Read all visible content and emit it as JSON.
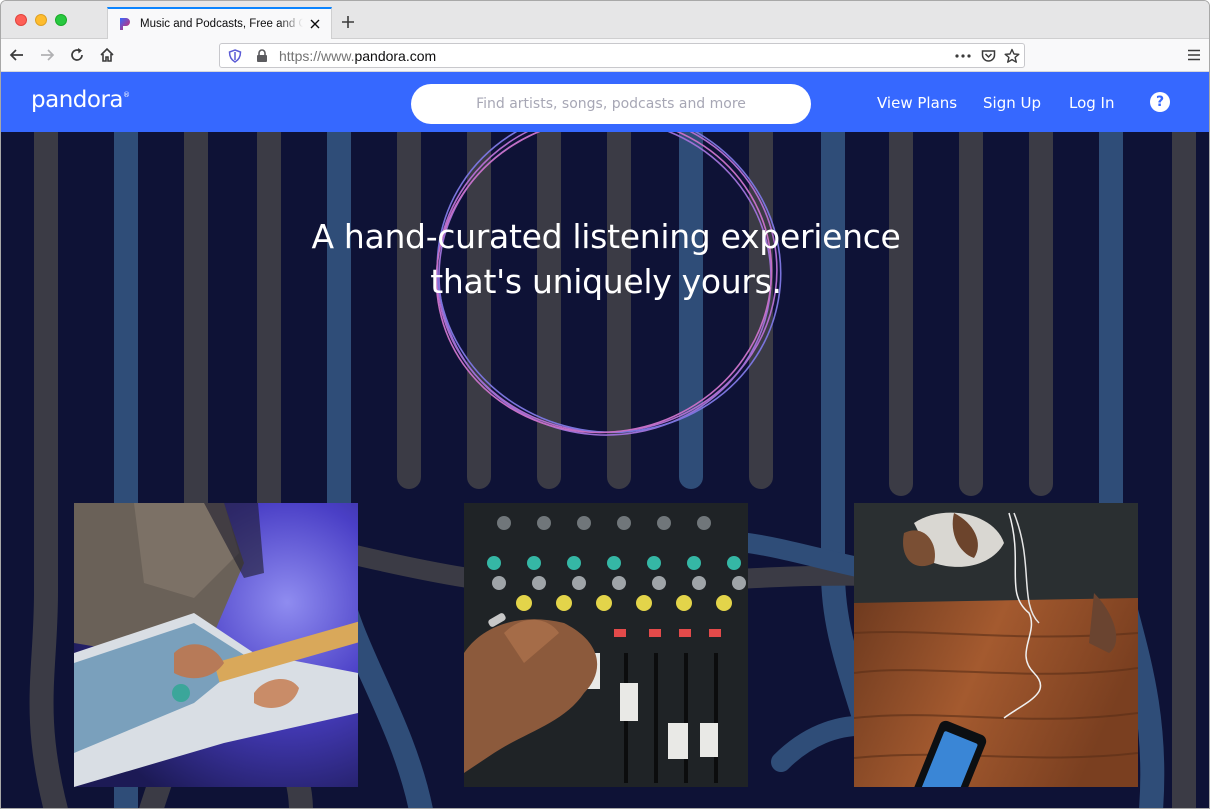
{
  "browser": {
    "tab_title": "Music and Podcasts, Free and On-Demand",
    "url_protocol": "https://www.",
    "url_domain": "pandora.com",
    "icons": [
      "back-arrow-icon",
      "forward-arrow-icon",
      "reload-icon",
      "home-icon",
      "shield-icon",
      "lock-icon",
      "more-dots-icon",
      "pocket-icon",
      "star-icon",
      "hamburger-menu-icon",
      "close-icon",
      "plus-icon"
    ]
  },
  "site": {
    "logo": "pandora",
    "logo_mark": "®",
    "search_placeholder": "Find artists, songs, podcasts and more",
    "nav": {
      "view_plans": "View Plans",
      "sign_up": "Sign Up",
      "log_in": "Log In",
      "help": "?"
    },
    "hero_line1": "A hand-curated listening experience",
    "hero_line2": "that's uniquely yours.",
    "colors": {
      "header_blue": "#3668ff",
      "page_navy": "#0e1236",
      "stripe_gray": "#3b3b45",
      "stripe_blue": "#2f4d78",
      "circle_purple": "#b06ccc"
    },
    "photos": [
      "guitarist-photo",
      "mixing-console-photo",
      "headphones-phone-photo"
    ]
  }
}
